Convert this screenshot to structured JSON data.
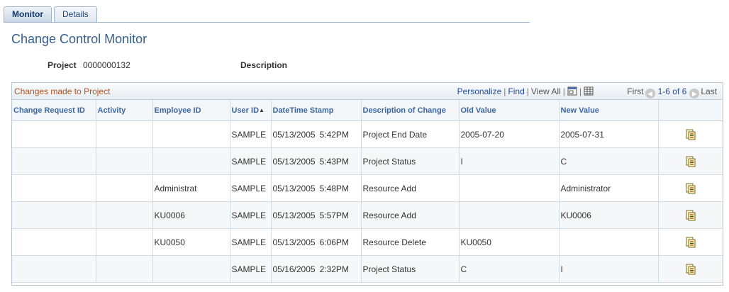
{
  "tabs": [
    {
      "label": "Monitor",
      "active": true
    },
    {
      "label": "Details",
      "active": false
    }
  ],
  "page_title": "Change Control Monitor",
  "project": {
    "label": "Project",
    "value": "0000000132"
  },
  "description": {
    "label": "Description",
    "value": ""
  },
  "grid": {
    "title": "Changes made to Project",
    "personalize": "Personalize",
    "find": "Find",
    "view_all": "View All",
    "first": "First",
    "count": "1-6 of 6",
    "last": "Last",
    "columns": [
      "Change Request ID",
      "Activity",
      "Employee ID",
      "User ID",
      "DateTime Stamp",
      "Description of Change",
      "Old Value",
      "New Value",
      ""
    ],
    "sort_column": "User ID",
    "rows": [
      {
        "change_request_id": "",
        "activity": "",
        "employee_id": "",
        "user_id": "SAMPLE",
        "date": "05/13/2005",
        "time": "5:42PM",
        "description": "Project End Date",
        "old_value": "2005-07-20",
        "new_value": "2005-07-31"
      },
      {
        "change_request_id": "",
        "activity": "",
        "employee_id": "",
        "user_id": "SAMPLE",
        "date": "05/13/2005",
        "time": "5:43PM",
        "description": "Project Status",
        "old_value": "I",
        "new_value": "C"
      },
      {
        "change_request_id": "",
        "activity": "",
        "employee_id": "Administrat",
        "user_id": "SAMPLE",
        "date": "05/13/2005",
        "time": "5:48PM",
        "description": "Resource Add",
        "old_value": "",
        "new_value": "Administrator"
      },
      {
        "change_request_id": "",
        "activity": "",
        "employee_id": "KU0006",
        "user_id": "SAMPLE",
        "date": "05/13/2005",
        "time": "5:57PM",
        "description": "Resource Add",
        "old_value": "",
        "new_value": "KU0006"
      },
      {
        "change_request_id": "",
        "activity": "",
        "employee_id": "KU0050",
        "user_id": "SAMPLE",
        "date": "05/13/2005",
        "time": "6:06PM",
        "description": "Resource Delete",
        "old_value": "KU0050",
        "new_value": ""
      },
      {
        "change_request_id": "",
        "activity": "",
        "employee_id": "",
        "user_id": "SAMPLE",
        "date": "05/16/2005",
        "time": "2:32PM",
        "description": "Project Status",
        "old_value": "C",
        "new_value": "I"
      }
    ]
  },
  "icons": {
    "zoom": "zoom-icon",
    "download": "spreadsheet-icon",
    "prev": "previous-icon",
    "next": "next-icon",
    "detail": "details-icon"
  },
  "colors": {
    "title": "#355f8d",
    "grid_title": "#b5501b",
    "link": "#1f4a9a",
    "header_text": "#3b66a5"
  }
}
